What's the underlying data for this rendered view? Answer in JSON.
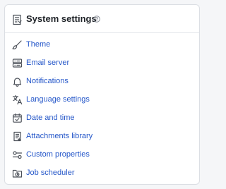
{
  "panel": {
    "title": "System settings",
    "items": [
      {
        "label": "Theme",
        "icon": "brush-icon"
      },
      {
        "label": "Email server",
        "icon": "server-icon"
      },
      {
        "label": "Notifications",
        "icon": "bell-icon"
      },
      {
        "label": "Language settings",
        "icon": "translate-icon"
      },
      {
        "label": "Date and time",
        "icon": "calendar-check-icon"
      },
      {
        "label": "Attachments library",
        "icon": "document-icon"
      },
      {
        "label": "Custom properties",
        "icon": "toggle-icon"
      },
      {
        "label": "Job scheduler",
        "icon": "folder-clock-icon"
      }
    ]
  }
}
